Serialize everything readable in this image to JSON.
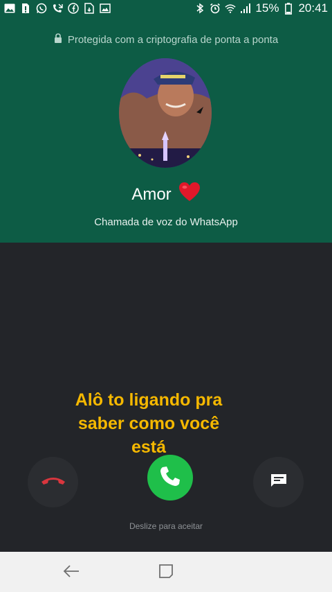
{
  "status_bar": {
    "battery_percent": "15%",
    "time": "20:41",
    "left_icons": [
      "image-icon",
      "sim-icon",
      "whatsapp-icon",
      "missed-call-icon",
      "facebook-icon",
      "download-icon",
      "gallery-icon"
    ],
    "right_icons": [
      "bluetooth-icon",
      "alarm-icon",
      "wifi-icon",
      "signal-icon",
      "battery-icon"
    ]
  },
  "header": {
    "encryption_text": "Protegida com a criptografia de ponta a ponta",
    "contact_name": "Amor",
    "contact_emoji": "❤️",
    "call_type": "Chamada de voz do WhatsApp"
  },
  "overlay_caption": {
    "line1": "Alô to ligando pra",
    "line2": "saber como você",
    "line3": "está"
  },
  "controls": {
    "slide_hint": "Deslize para aceitar"
  },
  "colors": {
    "header_green": "#0d5c45",
    "dark_bg": "#232529",
    "accept_green": "#1fbf4a",
    "decline_red": "#d9363e",
    "caption_yellow": "#f5b800"
  }
}
